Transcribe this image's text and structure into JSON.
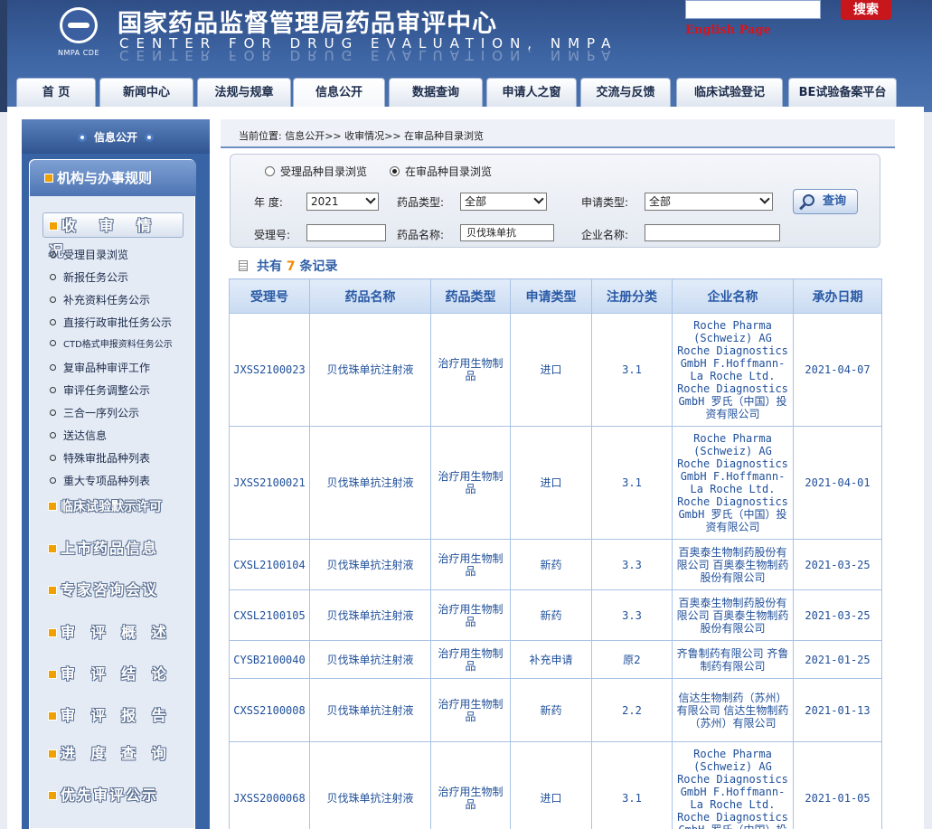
{
  "header": {
    "logo_caption": "NMPA CDE",
    "title_cn": "国家药品监督管理局药品审评中心",
    "title_en": "CENTER FOR DRUG EVALUATION, NMPA",
    "search_button": "搜索",
    "english_link": "English Page"
  },
  "nav": {
    "tabs": [
      "首  页",
      "新闻中心",
      "法规与规章",
      "信息公开",
      "数据查询",
      "申请人之窗",
      "交流与反馈",
      "临床试验登记",
      "BE试验备案平台"
    ],
    "active": "信息公开"
  },
  "sidebar": {
    "header": "信息公开",
    "group1": "机构与办事规则",
    "group2": "收 审 情 况",
    "items": [
      "受理目录浏览",
      "新报任务公示",
      "补充资料任务公示",
      "直接行政审批任务公示",
      "CTD格式申报资料任务公示",
      "复审品种审评工作",
      "审评任务调整公示",
      "三合一序列公示",
      "送达信息",
      "特殊审批品种列表",
      "重大专项品种列表"
    ],
    "sections": [
      "临床试验默示许可",
      "上市药品信息",
      "专家咨询会议",
      "审 评 概 述",
      "审 评 结 论",
      "审 评 报 告",
      "进 度 查 询",
      "优先审评公示"
    ]
  },
  "breadcrumb": "当前位置: 信息公开>> 收审情况>> 在审品种目录浏览",
  "filters": {
    "radio1": "受理品种目录浏览",
    "radio2": "在审品种目录浏览",
    "radio_selected": 2,
    "year_label": "年   度:",
    "year_value": "2021",
    "drug_type_label": "药品类型:",
    "drug_type_value": "全部",
    "apply_type_label": "申请类型:",
    "apply_type_value": "全部",
    "accept_no_label": "受理号:",
    "accept_no_value": "",
    "drug_name_label": "药品名称:",
    "drug_name_value": "贝伐珠单抗",
    "company_label": "企业名称:",
    "company_value": "",
    "query_button": "查询"
  },
  "results": {
    "prefix": "共有",
    "count": "7",
    "suffix": "条记录"
  },
  "table": {
    "columns": [
      "受理号",
      "药品名称",
      "药品类型",
      "申请类型",
      "注册分类",
      "企业名称",
      "承办日期"
    ],
    "rows": [
      [
        "JXSS2100023",
        "贝伐珠单抗注射液",
        "治疗用生物制品",
        "进口",
        "3.1",
        "Roche Pharma (Schweiz) AG Roche Diagnostics GmbH F.Hoffmann-La Roche Ltd. Roche Diagnostics GmbH 罗氏（中国）投资有限公司",
        "2021-04-07"
      ],
      [
        "JXSS2100021",
        "贝伐珠单抗注射液",
        "治疗用生物制品",
        "进口",
        "3.1",
        "Roche Pharma (Schweiz) AG Roche Diagnostics GmbH F.Hoffmann-La Roche Ltd. Roche Diagnostics GmbH 罗氏（中国）投资有限公司",
        "2021-04-01"
      ],
      [
        "CXSL2100104",
        "贝伐珠单抗注射液",
        "治疗用生物制品",
        "新药",
        "3.3",
        "百奥泰生物制药股份有限公司 百奥泰生物制药股份有限公司",
        "2021-03-25"
      ],
      [
        "CXSL2100105",
        "贝伐珠单抗注射液",
        "治疗用生物制品",
        "新药",
        "3.3",
        "百奥泰生物制药股份有限公司 百奥泰生物制药股份有限公司",
        "2021-03-25"
      ],
      [
        "CYSB2100040",
        "贝伐珠单抗注射液",
        "治疗用生物制品",
        "补充申请",
        "原2",
        "齐鲁制药有限公司 齐鲁制药有限公司",
        "2021-01-25"
      ],
      [
        "CXSS2100008",
        "贝伐珠单抗注射液",
        "治疗用生物制品",
        "新药",
        "2.2",
        "信达生物制药（苏州）有限公司 信达生物制药（苏州）有限公司",
        "2021-01-13"
      ],
      [
        "JXSS2000068",
        "贝伐珠单抗注射液",
        "治疗用生物制品",
        "进口",
        "3.1",
        "Roche Pharma (Schweiz) AG Roche Diagnostics GmbH F.Hoffmann-La Roche Ltd. Roche Diagnostics GmbH 罗氏（中国）投资有限公司",
        "2021-01-05"
      ]
    ]
  }
}
